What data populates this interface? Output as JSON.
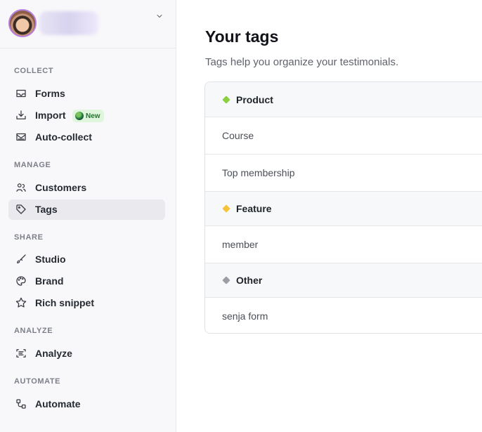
{
  "sidebar": {
    "sections": [
      {
        "label": "COLLECT",
        "items": [
          {
            "label": "Forms",
            "icon": "inbox-icon"
          },
          {
            "label": "Import",
            "icon": "download-icon",
            "badge": "New"
          },
          {
            "label": "Auto-collect",
            "icon": "mail-collect-icon"
          }
        ]
      },
      {
        "label": "MANAGE",
        "items": [
          {
            "label": "Customers",
            "icon": "users-icon"
          },
          {
            "label": "Tags",
            "icon": "tag-icon",
            "active": true
          }
        ]
      },
      {
        "label": "SHARE",
        "items": [
          {
            "label": "Studio",
            "icon": "brush-icon"
          },
          {
            "label": "Brand",
            "icon": "palette-icon"
          },
          {
            "label": "Rich snippet",
            "icon": "star-icon"
          }
        ]
      },
      {
        "label": "ANALYZE",
        "items": [
          {
            "label": "Analyze",
            "icon": "analyze-icon"
          }
        ]
      },
      {
        "label": "AUTOMATE",
        "items": [
          {
            "label": "Automate",
            "icon": "workflow-icon"
          }
        ]
      }
    ]
  },
  "main": {
    "title": "Your tags",
    "subtitle": "Tags help you organize your testimonials."
  },
  "tag_groups": [
    {
      "name": "Product",
      "color": "#8bd13f",
      "tags": [
        "Course",
        "Top membership"
      ]
    },
    {
      "name": "Feature",
      "color": "#f6c33a",
      "tags": [
        "member"
      ]
    },
    {
      "name": "Other",
      "color": "#9b9ea5",
      "tags": [
        "senja form"
      ]
    }
  ]
}
